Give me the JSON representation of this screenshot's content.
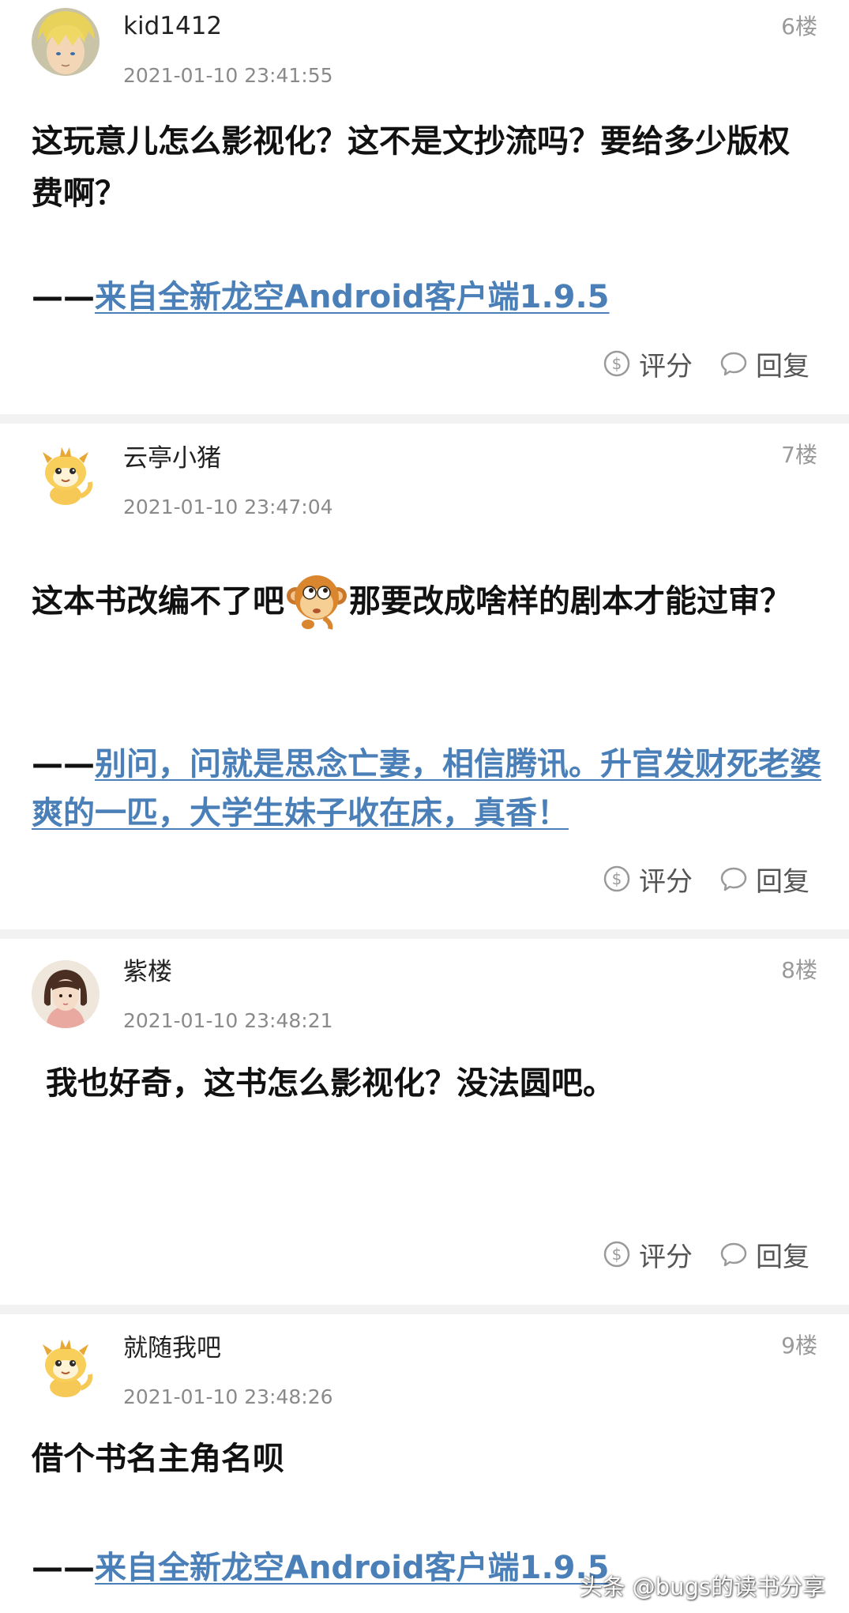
{
  "posts": [
    {
      "username": "kid1412",
      "timestamp": "2021-01-10 23:41:55",
      "floor": "6楼",
      "avatar": "anime-blonde-character-avatar",
      "content": "这玩意儿怎么影视化？这不是文抄流吗？要给多少版权费啊？",
      "signature_dash": "——",
      "signature_link": "来自全新龙空Android客户端1.9.5"
    },
    {
      "username": "云亭小猪",
      "timestamp": "2021-01-10 23:47:04",
      "floor": "7楼",
      "avatar": "yellow-dragon-mascot-avatar",
      "content_part1": "这本书改编不了吧",
      "content_emoji": "monkey-thinking-emoji",
      "content_part2": "那要改成啥样的剧本才能过审？",
      "signature_dash": "——",
      "signature_link": "别问，问就是思念亡妻，相信腾讯。升官发财死老婆爽的一匹，大学生妹子收在床，真香！"
    },
    {
      "username": "紫楼",
      "timestamp": "2021-01-10 23:48:21",
      "floor": "8楼",
      "avatar": "photo-girl-avatar",
      "content": "我也好奇，这书怎么影视化？没法圆吧。"
    },
    {
      "username": "就随我吧",
      "timestamp": "2021-01-10 23:48:26",
      "floor": "9楼",
      "avatar": "yellow-dragon-mascot-avatar",
      "content": "借个书名主角名呗",
      "signature_dash": "——",
      "signature_link": "来自全新龙空Android客户端1.9.5"
    }
  ],
  "actions": {
    "rate_label": "评分",
    "reply_label": "回复",
    "rate_icon": "coin-icon",
    "reply_icon": "speech-bubble-icon"
  },
  "watermark": "头条 @bugs的读书分享",
  "colors": {
    "link": "#4a7fb8",
    "meta": "#8a8a8a",
    "divider": "#f2f2f2"
  }
}
